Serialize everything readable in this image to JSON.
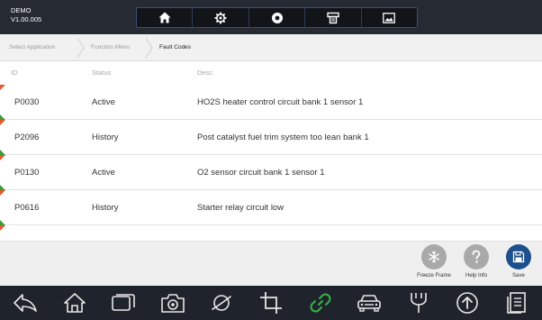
{
  "app": {
    "name": "DEMO",
    "version": "V1.00.005"
  },
  "toolbar": {
    "buttons": [
      {
        "icon": "home-icon"
      },
      {
        "icon": "gear-icon"
      },
      {
        "icon": "record-icon"
      },
      {
        "icon": "printer-icon"
      },
      {
        "icon": "image-icon"
      }
    ]
  },
  "breadcrumb": [
    "Select Application",
    "Function Menu",
    "Fault Codes"
  ],
  "table": {
    "columns": [
      "ID",
      "Status",
      "Desc"
    ],
    "rows": [
      {
        "id": "P0030",
        "status": "Active",
        "desc": "HO2S heater control circuit bank 1  sensor 1"
      },
      {
        "id": "P2096",
        "status": "History",
        "desc": "Post catalyst fuel trim system too lean bank 1"
      },
      {
        "id": "P0130",
        "status": "Active",
        "desc": "O2 sensor circuit bank 1 sensor 1"
      },
      {
        "id": "P0616",
        "status": "History",
        "desc": "Starter relay circuit low"
      }
    ]
  },
  "actions": {
    "freeze_frame": {
      "label": "Freeze Frame",
      "icon": "snowflake-icon",
      "color": "#a9a9a9"
    },
    "help_info": {
      "label": "Help Info",
      "icon": "question-icon",
      "color": "#a9a9a9"
    },
    "save": {
      "label": "Save",
      "icon": "save-icon",
      "color": "#1d4f8c"
    }
  },
  "navbar": {
    "buttons": [
      "back-icon",
      "home-icon",
      "recent-apps-icon",
      "camera-icon",
      "browser-icon",
      "crop-icon",
      "link-icon",
      "car-icon",
      "vci-icon",
      "upload-icon",
      "report-icon"
    ],
    "highlight_color": "#37b34a"
  },
  "colors": {
    "active_flag": "#e9572c",
    "history_flag": "#3d9c3a",
    "topbar": "#262a33",
    "navbar": "#1f232b"
  }
}
